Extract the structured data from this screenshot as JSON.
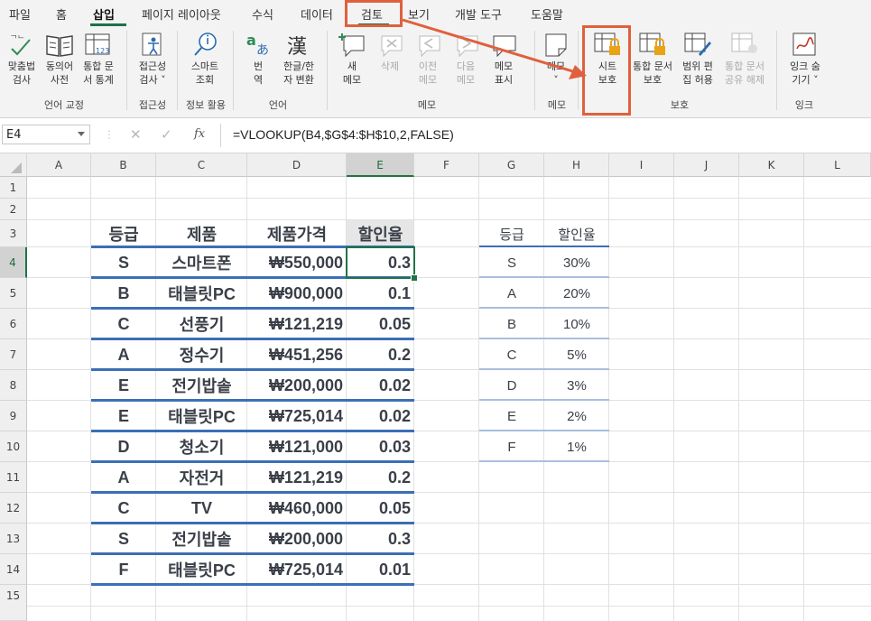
{
  "ribbon_tabs": [
    {
      "label": "파일"
    },
    {
      "label": "홈"
    },
    {
      "label": "삽입"
    },
    {
      "label": "페이지 레이아웃"
    },
    {
      "label": "수식"
    },
    {
      "label": "데이터"
    },
    {
      "label": "검토"
    },
    {
      "label": "보기"
    },
    {
      "label": "개발 도구"
    },
    {
      "label": "도움말"
    }
  ],
  "ribbon_buttons": {
    "spell": "맞춤법\n검사",
    "thesaurus": "동의어\n사전",
    "stats": "통합 문\n서 통계",
    "access": "접근성\n검사 ˅",
    "smart": "스마트\n조회",
    "translate": "번\n역",
    "hanja": "한글/한\n자 변환",
    "new_memo": "새\n메모",
    "delete": "삭제",
    "prev": "이전\n메모",
    "next": "다음\n메모",
    "show_memo": "메모\n표시",
    "note": "메모\n˅",
    "protect_sheet": "시트\n보호",
    "protect_wb": "통합 문서\n보호",
    "allow_edit": "범위 편\n집 허용",
    "unshare": "통합 문서\n공유 해제",
    "ink": "잉크 숨\n기기 ˅"
  },
  "ribbon_groups": {
    "proofing": "언어 교정",
    "accessibility": "접근성",
    "insights": "정보 활용",
    "language": "언어",
    "comments": "메모",
    "notes": "메모",
    "protect": "보호",
    "ink": "잉크"
  },
  "formula_bar": {
    "name_box": "E4",
    "cancel_icon": "✕",
    "enter_icon": "✓",
    "fx": "fx",
    "formula": "=VLOOKUP(B4,$G$4:$H$10,2,FALSE)"
  },
  "columns": [
    "A",
    "B",
    "C",
    "D",
    "E",
    "F",
    "G",
    "H",
    "I",
    "J",
    "K",
    "L"
  ],
  "rows": [
    "1",
    "2",
    "3",
    "4",
    "5",
    "6",
    "7",
    "8",
    "9",
    "10",
    "11",
    "12",
    "13",
    "14",
    "15"
  ],
  "main_table": {
    "headers": [
      "등급",
      "제품",
      "제품가격",
      "할인율"
    ],
    "rows": [
      [
        "S",
        "스마트폰",
        "₩550,000",
        "0.3"
      ],
      [
        "B",
        "태블릿PC",
        "₩900,000",
        "0.1"
      ],
      [
        "C",
        "선풍기",
        "₩121,219",
        "0.05"
      ],
      [
        "A",
        "정수기",
        "₩451,256",
        "0.2"
      ],
      [
        "E",
        "전기밥솥",
        "₩200,000",
        "0.02"
      ],
      [
        "E",
        "태블릿PC",
        "₩725,014",
        "0.02"
      ],
      [
        "D",
        "청소기",
        "₩121,000",
        "0.03"
      ],
      [
        "A",
        "자전거",
        "₩121,219",
        "0.2"
      ],
      [
        "C",
        "TV",
        "₩460,000",
        "0.05"
      ],
      [
        "S",
        "전기밥솥",
        "₩200,000",
        "0.3"
      ],
      [
        "F",
        "태블릿PC",
        "₩725,014",
        "0.01"
      ]
    ]
  },
  "lookup_table": {
    "headers": [
      "등급",
      "할인율"
    ],
    "rows": [
      [
        "S",
        "30%"
      ],
      [
        "A",
        "20%"
      ],
      [
        "B",
        "10%"
      ],
      [
        "C",
        "5%"
      ],
      [
        "D",
        "3%"
      ],
      [
        "E",
        "2%"
      ],
      [
        "F",
        "1%"
      ]
    ]
  },
  "colors": {
    "accent": "#217346",
    "highlight": "#e0603d",
    "table_line": "#3b6fb6"
  }
}
